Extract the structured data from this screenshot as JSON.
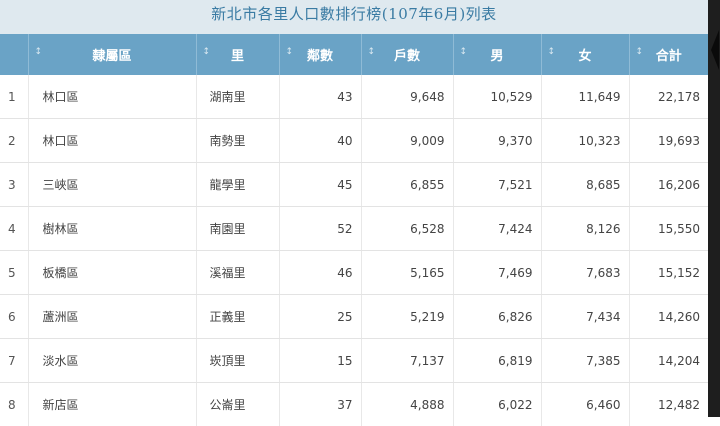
{
  "title": "新北市各里人口數排行榜(107年6月)列表",
  "columns": [
    "",
    "隸屬區",
    "里",
    "鄰數",
    "戶數",
    "男",
    "女",
    "合計"
  ],
  "sort_icon": "↕",
  "rows": [
    [
      "1",
      "林口區",
      "湖南里",
      "43",
      "9,648",
      "10,529",
      "11,649",
      "22,178"
    ],
    [
      "2",
      "林口區",
      "南勢里",
      "40",
      "9,009",
      "9,370",
      "10,323",
      "19,693"
    ],
    [
      "3",
      "三峽區",
      "龍學里",
      "45",
      "6,855",
      "7,521",
      "8,685",
      "16,206"
    ],
    [
      "4",
      "樹林區",
      "南園里",
      "52",
      "6,528",
      "7,424",
      "8,126",
      "15,550"
    ],
    [
      "5",
      "板橋區",
      "溪福里",
      "46",
      "5,165",
      "7,469",
      "7,683",
      "15,152"
    ],
    [
      "6",
      "蘆洲區",
      "正義里",
      "25",
      "5,219",
      "6,826",
      "7,434",
      "14,260"
    ],
    [
      "7",
      "淡水區",
      "崁頂里",
      "15",
      "7,137",
      "6,819",
      "7,385",
      "14,204"
    ],
    [
      "8",
      "新店區",
      "公崙里",
      "37",
      "4,888",
      "6,022",
      "6,460",
      "12,482"
    ]
  ],
  "colors": {
    "header": "#6aa3c6",
    "title_bg": "#dfe9ef",
    "title_text": "#3a7ba3"
  }
}
